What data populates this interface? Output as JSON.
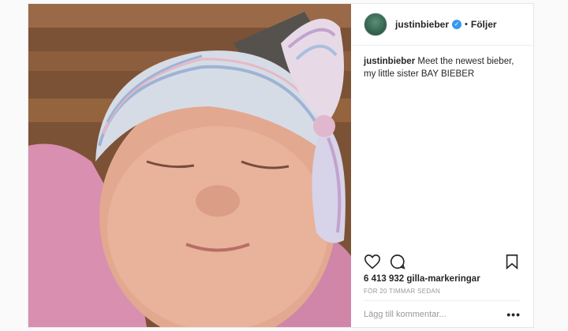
{
  "post": {
    "username": "justinbieber",
    "verified": true,
    "separator": "•",
    "follow_label": "Följer",
    "caption_user": "justinbieber",
    "caption_text": "Meet the newest bieber, my little sister BAY BIEBER",
    "likes": "6 413 932 gilla-markeringar",
    "timestamp": "FÖR 20 TIMMAR SEDAN",
    "comment_placeholder": "Lägg till kommentar...",
    "more_label": "•••"
  },
  "icons": {
    "like": "heart-icon",
    "comment": "speech-bubble-icon",
    "save": "bookmark-icon",
    "verified": "check-icon"
  },
  "colors": {
    "verified_badge": "#3897f0",
    "text": "#262626",
    "muted": "#999999"
  }
}
